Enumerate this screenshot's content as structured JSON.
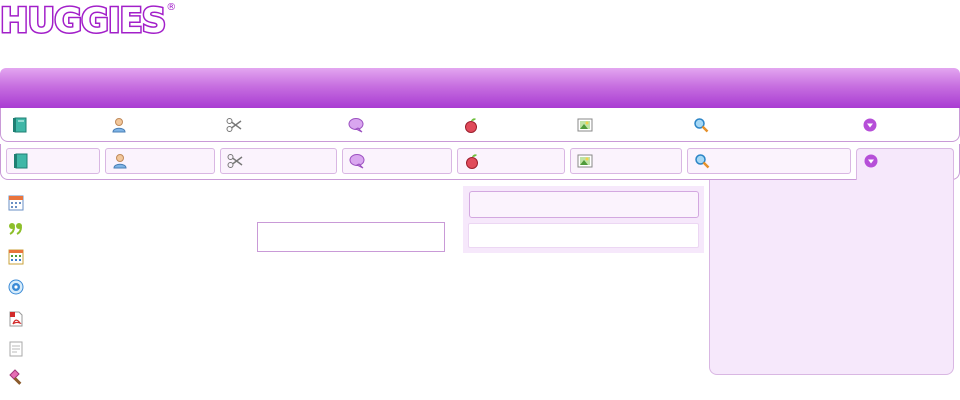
{
  "brand": {
    "logo_text": "HUGGIES",
    "registered_mark": "®"
  },
  "colors": {
    "brand_purple": "#a21fc9",
    "bar_top": "#e3a6f0",
    "bar_bottom": "#a93cd2",
    "panel_bg": "#f6e8fb",
    "button_bg": "#fbf3fd",
    "border": "#c99ad7"
  },
  "toolbar_primary": {
    "items": [
      {
        "icon": "book-icon"
      },
      {
        "icon": "user-icon"
      },
      {
        "icon": "scissors-icon"
      },
      {
        "icon": "speech-bubble-icon"
      },
      {
        "icon": "apple-icon"
      },
      {
        "icon": "picture-icon"
      },
      {
        "icon": "search-icon"
      },
      {
        "icon": "dropdown-arrow-icon"
      }
    ]
  },
  "toolbar_secondary": {
    "items": [
      {
        "icon": "book-icon"
      },
      {
        "icon": "user-icon"
      },
      {
        "icon": "scissors-icon"
      },
      {
        "icon": "speech-bubble-icon"
      },
      {
        "icon": "apple-icon"
      },
      {
        "icon": "picture-icon"
      },
      {
        "icon": "search-icon"
      },
      {
        "icon": "dropdown-arrow-icon",
        "state": "open"
      }
    ]
  },
  "sidebar_icons": [
    "calendar-icon",
    "quote-icon",
    "calendar-grid-icon",
    "target-icon",
    "pdf-icon",
    "document-icon",
    "brush-icon"
  ]
}
